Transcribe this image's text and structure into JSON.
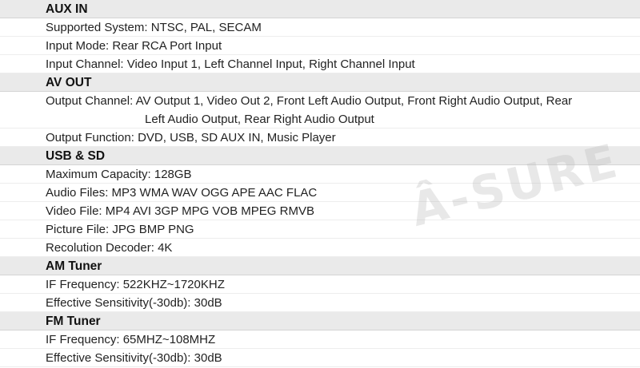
{
  "watermark": "Â-SURE",
  "sections": {
    "aux_in": {
      "title": "AUX IN",
      "supported_system": "Supported System: NTSC, PAL, SECAM",
      "input_mode": "Input Mode: Rear RCA Port Input",
      "input_channel": "Input Channel: Video Input 1, Left Channel Input, Right Channel Input"
    },
    "av_out": {
      "title": "AV OUT",
      "output_channel_line1": "Output Channel: AV Output 1, Video Out 2, Front Left Audio Output, Front Right Audio Output, Rear",
      "output_channel_line2": "Left Audio Output, Rear Right Audio Output",
      "output_function": "Output Function: DVD, USB, SD AUX IN, Music Player"
    },
    "usb_sd": {
      "title": "USB & SD",
      "max_capacity": "Maximum Capacity: 128GB",
      "audio_files": "Audio Files: MP3 WMA WAV OGG APE AAC FLAC",
      "video_file": "Video File: MP4 AVI 3GP MPG VOB MPEG RMVB",
      "picture_file": "Picture File: JPG BMP PNG",
      "resolution_decoder": "Recolution Decoder: 4K"
    },
    "am_tuner": {
      "title": "AM Tuner",
      "if_frequency": "IF Frequency: 522KHZ~1720KHZ",
      "sensitivity": "Effective Sensitivity(-30db): 30dB"
    },
    "fm_tuner": {
      "title": "FM Tuner",
      "if_frequency": "IF Frequency: 65MHZ~108MHZ",
      "sensitivity": "Effective Sensitivity(-30db): 30dB"
    }
  }
}
